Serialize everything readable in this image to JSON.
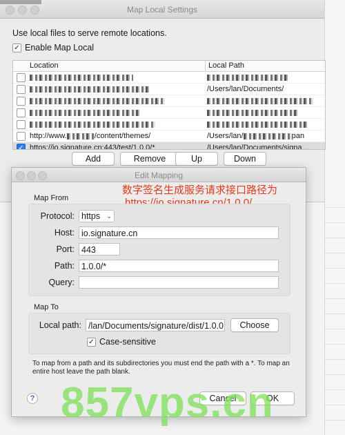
{
  "main_window": {
    "title": "Map Local Settings",
    "description": "Use local files to serve remote locations.",
    "enable_label": "Enable Map Local",
    "enable_checked": true,
    "columns": [
      "Location",
      "Local Path"
    ],
    "rows": [
      {
        "location": "",
        "local_path": "",
        "checked": false,
        "redacted": true
      },
      {
        "location": "",
        "local_path": "/Users/lan/Documents/",
        "checked": false,
        "redacted": true
      },
      {
        "location": "",
        "local_path": "",
        "checked": false,
        "redacted": true
      },
      {
        "location": "",
        "local_path": "",
        "checked": false,
        "redacted": true
      },
      {
        "location": "",
        "local_path": "",
        "checked": false,
        "redacted": true
      },
      {
        "location": "http://www.",
        "location_tail": "/content/themes/",
        "local_path": "/Users/lan/",
        "local_tail": "pan",
        "checked": false,
        "redacted": false
      },
      {
        "location": "https://io.signature.cn:443/test/1.0.0/*",
        "local_path": "/Users/lan/Documents/signa...",
        "checked": true,
        "redacted": false,
        "selected": true
      }
    ],
    "buttons": {
      "add": "Add",
      "remove": "Remove",
      "up": "Up",
      "down": "Down"
    }
  },
  "dialog": {
    "title": "Edit Mapping",
    "annotation_line1": "数字签名生成服务请求接口路径为",
    "annotation_line2": "https://io.signature.cn/1.0.0/",
    "map_from": {
      "group_label": "Map From",
      "protocol_label": "Protocol:",
      "protocol_value": "https",
      "host_label": "Host:",
      "host_value": "io.signature.cn",
      "port_label": "Port:",
      "port_value": "443",
      "path_label": "Path:",
      "path_value": "1.0.0/*",
      "query_label": "Query:",
      "query_value": ""
    },
    "map_to": {
      "group_label": "Map To",
      "local_path_label": "Local path:",
      "local_path_value": "/lan/Documents/signature/dist/1.0.0",
      "choose_label": "Choose",
      "case_sensitive_label": "Case-sensitive",
      "case_sensitive_checked": true
    },
    "note": "To map from a path and its subdirectories you must end the path with a *. To map an entire host leave the path blank.",
    "help_label": "?",
    "cancel_label": "Cancel",
    "ok_label": "OK"
  },
  "watermark": "857vps.cn",
  "colors": {
    "annotation": "#e03a1a",
    "watermark": "#7ee05a",
    "checkbox_blue": "#2b7be4"
  }
}
